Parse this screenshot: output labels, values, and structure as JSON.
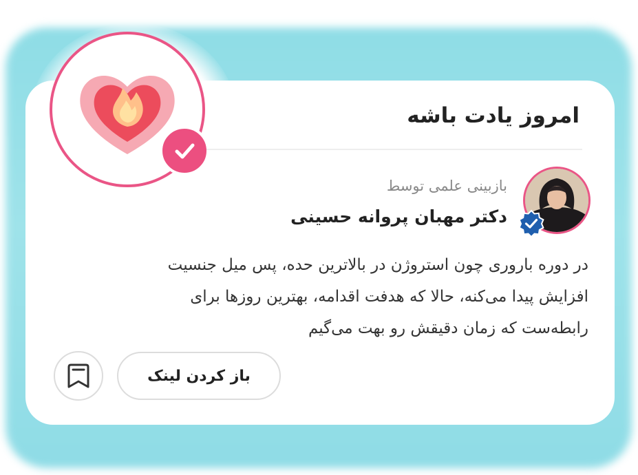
{
  "card": {
    "title": "امروز یادت باشه",
    "reviewed_by_label": "بازبینی علمی توسط",
    "author_name": "دکتر مهبان پروانه حسینی",
    "body_lines": [
      "در دوره باروری چون استروژن در بالاترین حده، پس میل جنسیت",
      "افزایش پیدا می‌کنه، حالا که هدفت اقدامه، بهترین روزها برای",
      "رابطه‌ست که زمان دقیقش رو بهت می‌گیم"
    ],
    "open_link_label": "باز کردن لینک"
  },
  "icons": {
    "badge": "heart-flame-icon",
    "badge_check": "check-icon",
    "verified": "verified-icon",
    "bookmark": "bookmark-icon"
  },
  "colors": {
    "accent_pink": "#ea5586",
    "glow_cyan": "#8fdde6",
    "verified_blue": "#1f5fae",
    "heart_outer": "#f6a9b3",
    "heart_inner": "#ec4c5c",
    "flame_outer": "#ffc08a",
    "flame_inner": "#ffe1a2"
  }
}
